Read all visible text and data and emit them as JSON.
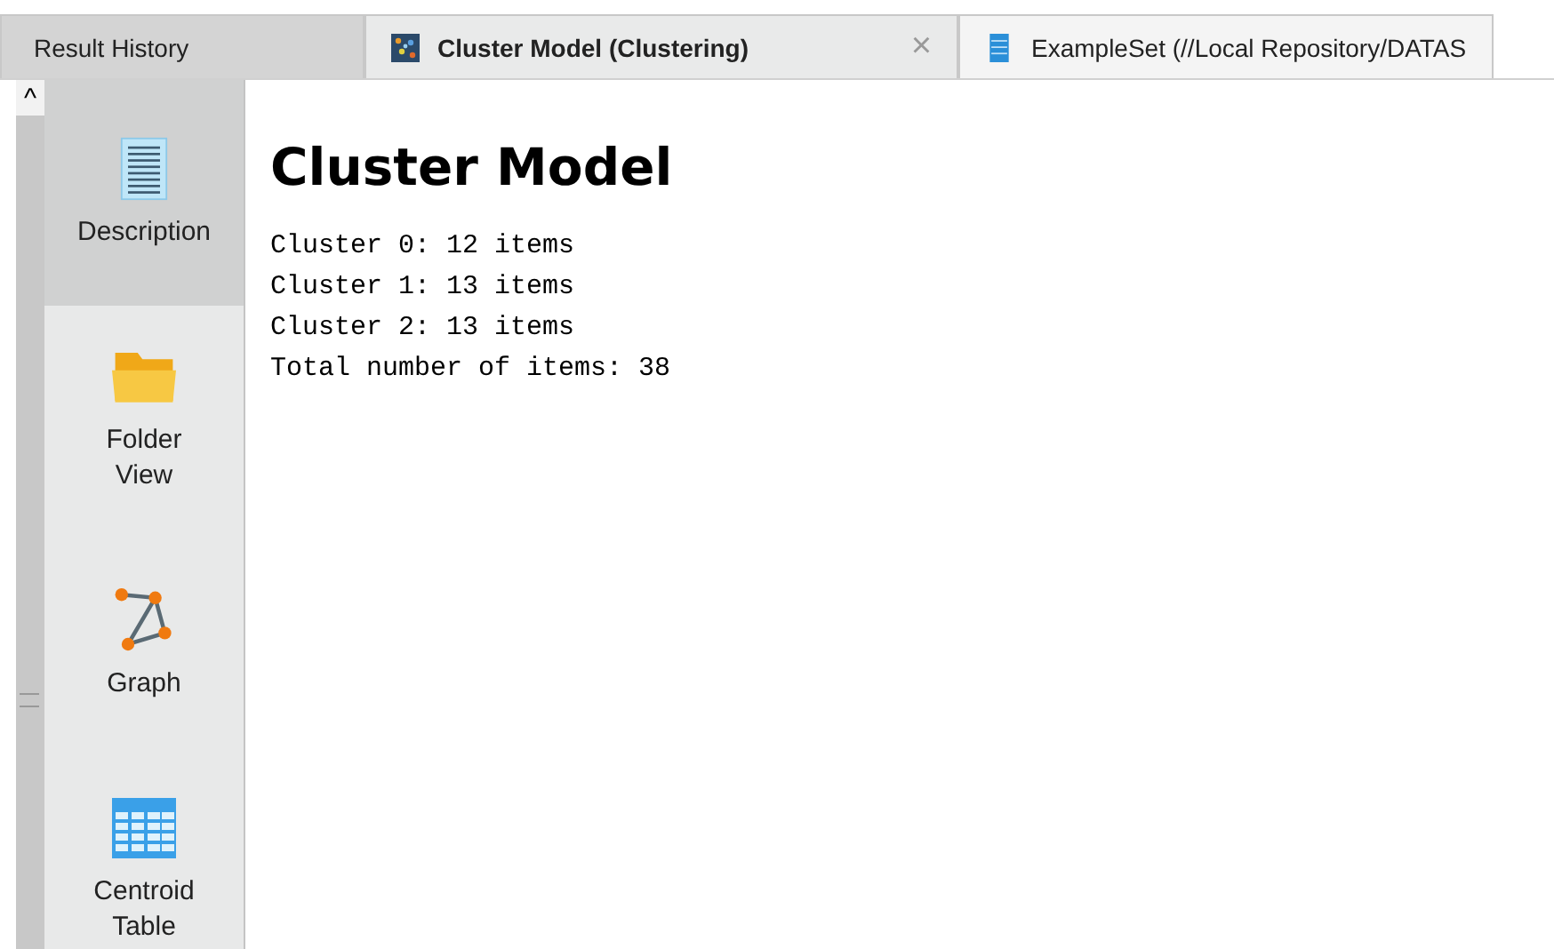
{
  "tabs": [
    {
      "label": "Result History",
      "kind": "plain",
      "selected": false,
      "closable": false
    },
    {
      "label": "Cluster Model (Clustering)",
      "kind": "cluster",
      "selected": true,
      "closable": true
    },
    {
      "label": "ExampleSet (//Local Repository/DATAS",
      "kind": "table",
      "selected": false,
      "closable": false
    }
  ],
  "close_glyph": "×",
  "scroll_up": "^",
  "views": [
    {
      "label": "Description",
      "kind": "document",
      "selected": true
    },
    {
      "label": "Folder\nView",
      "kind": "folder",
      "selected": false
    },
    {
      "label": "Graph",
      "kind": "graph",
      "selected": false
    },
    {
      "label": "Centroid\nTable",
      "kind": "grid",
      "selected": false
    }
  ],
  "content": {
    "title": "Cluster Model",
    "lines": [
      "Cluster 0: 12 items",
      "Cluster 1: 13 items",
      "Cluster 2: 13 items",
      "Total number of items: 38"
    ]
  }
}
